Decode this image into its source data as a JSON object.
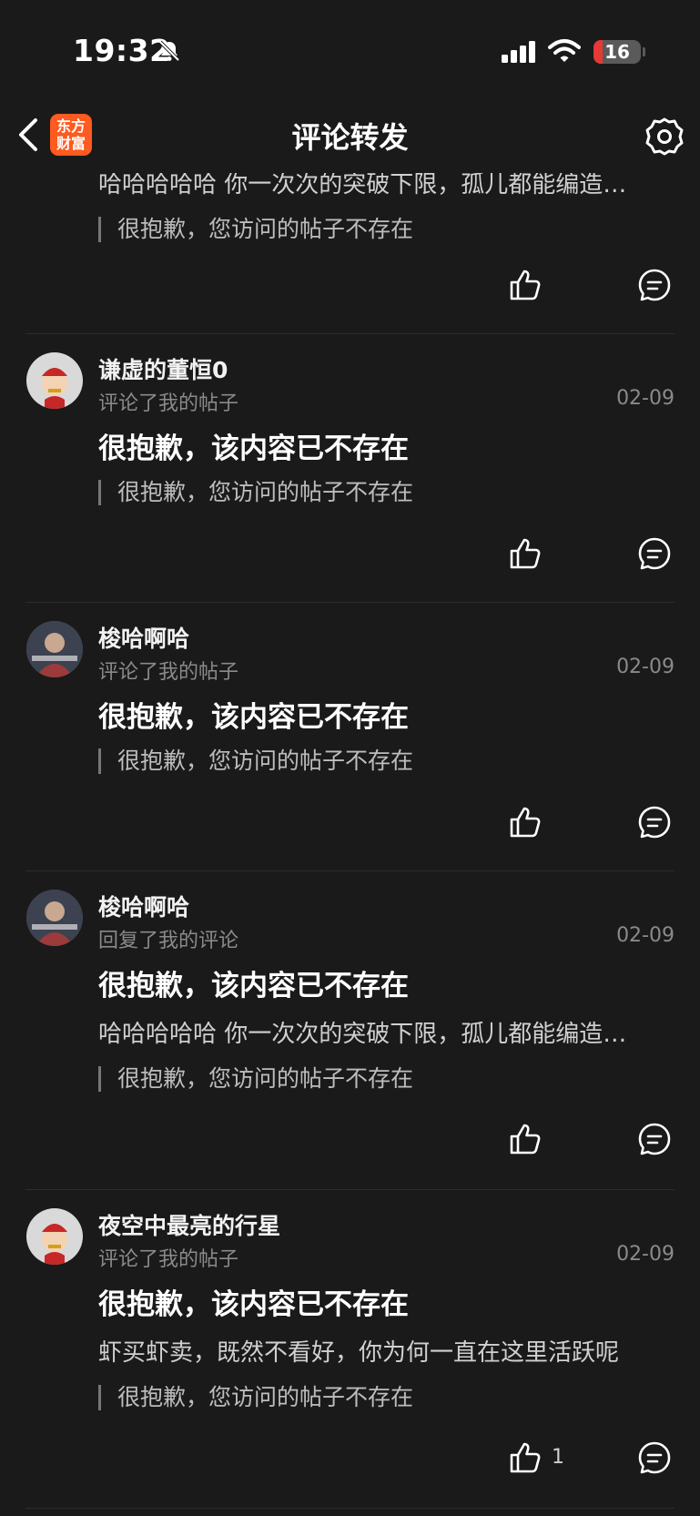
{
  "status": {
    "time": "19:32",
    "battery": "16"
  },
  "nav": {
    "title": "评论转发",
    "logo_line1": "东方",
    "logo_line2": "财富"
  },
  "items": [
    {
      "reply": "哈哈哈哈哈 你一次次的突破下限，孤儿都能编造…",
      "quote": "很抱歉，您访问的帖子不存在"
    },
    {
      "username": "谦虚的董恒0",
      "action": "评论了我的帖子",
      "date": "02-09",
      "content": "很抱歉，该内容已不存在",
      "quote": "很抱歉，您访问的帖子不存在"
    },
    {
      "username": "梭哈啊哈",
      "action": "评论了我的帖子",
      "date": "02-09",
      "content": "很抱歉，该内容已不存在",
      "quote": "很抱歉，您访问的帖子不存在"
    },
    {
      "username": "梭哈啊哈",
      "action": "回复了我的评论",
      "date": "02-09",
      "content": "很抱歉，该内容已不存在",
      "reply": "哈哈哈哈哈 你一次次的突破下限，孤儿都能编造…",
      "quote": "很抱歉，您访问的帖子不存在"
    },
    {
      "username": "夜空中最亮的行星",
      "action": "评论了我的帖子",
      "date": "02-09",
      "content": "很抱歉，该内容已不存在",
      "reply": "虾买虾卖，既然不看好，你为何一直在这里活跃呢",
      "quote": "很抱歉，您访问的帖子不存在",
      "likes": "1"
    }
  ],
  "icons": {
    "back": "chevron-left-icon",
    "settings": "gear-icon",
    "mute": "bell-slash-icon",
    "like": "thumbs-up-icon",
    "comment": "comment-bubble-icon"
  }
}
